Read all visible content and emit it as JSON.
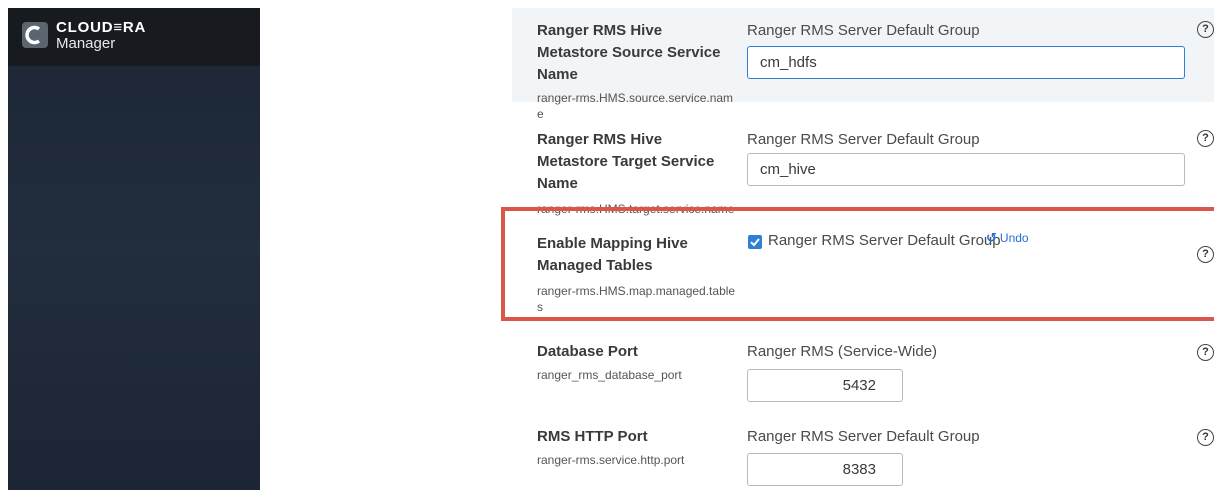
{
  "brand": {
    "line1": "CLOUD≡RA",
    "line2": "Manager"
  },
  "rows": [
    {
      "title": "Ranger RMS Hive Metastore Source Service Name",
      "key": "ranger-rms.HMS.source.service.name",
      "scope": "Ranger RMS Server Default Group",
      "value": "cm_hdfs",
      "help": "?"
    },
    {
      "title": "Ranger RMS Hive Metastore Target Service Name",
      "key": "ranger-rms.HMS.target.service.name",
      "scope": "Ranger RMS Server Default Group",
      "value": "cm_hive",
      "help": "?"
    },
    {
      "title": "Enable Mapping Hive Managed Tables",
      "key": "ranger-rms.HMS.map.managed.tables",
      "checkbox_label": "Ranger RMS Server Default Group",
      "checked": true,
      "undo_label": "Undo",
      "help": "?"
    },
    {
      "title": "Database Port",
      "key": "ranger_rms_database_port",
      "scope": "Ranger RMS (Service-Wide)",
      "value": "5432",
      "help": "?"
    },
    {
      "title": "RMS HTTP Port",
      "key": "ranger-rms.service.http.port",
      "scope": "Ranger RMS Server Default Group",
      "value": "8383",
      "help": "?"
    }
  ],
  "colors": {
    "accent": "#2f7fd6",
    "highlight": "#d9564a",
    "sidebar": "#1f2937"
  },
  "icons": {
    "logo": "cloudera-logo-icon",
    "help": "help-circle-icon",
    "undo": "undo-icon",
    "check": "check-icon"
  }
}
